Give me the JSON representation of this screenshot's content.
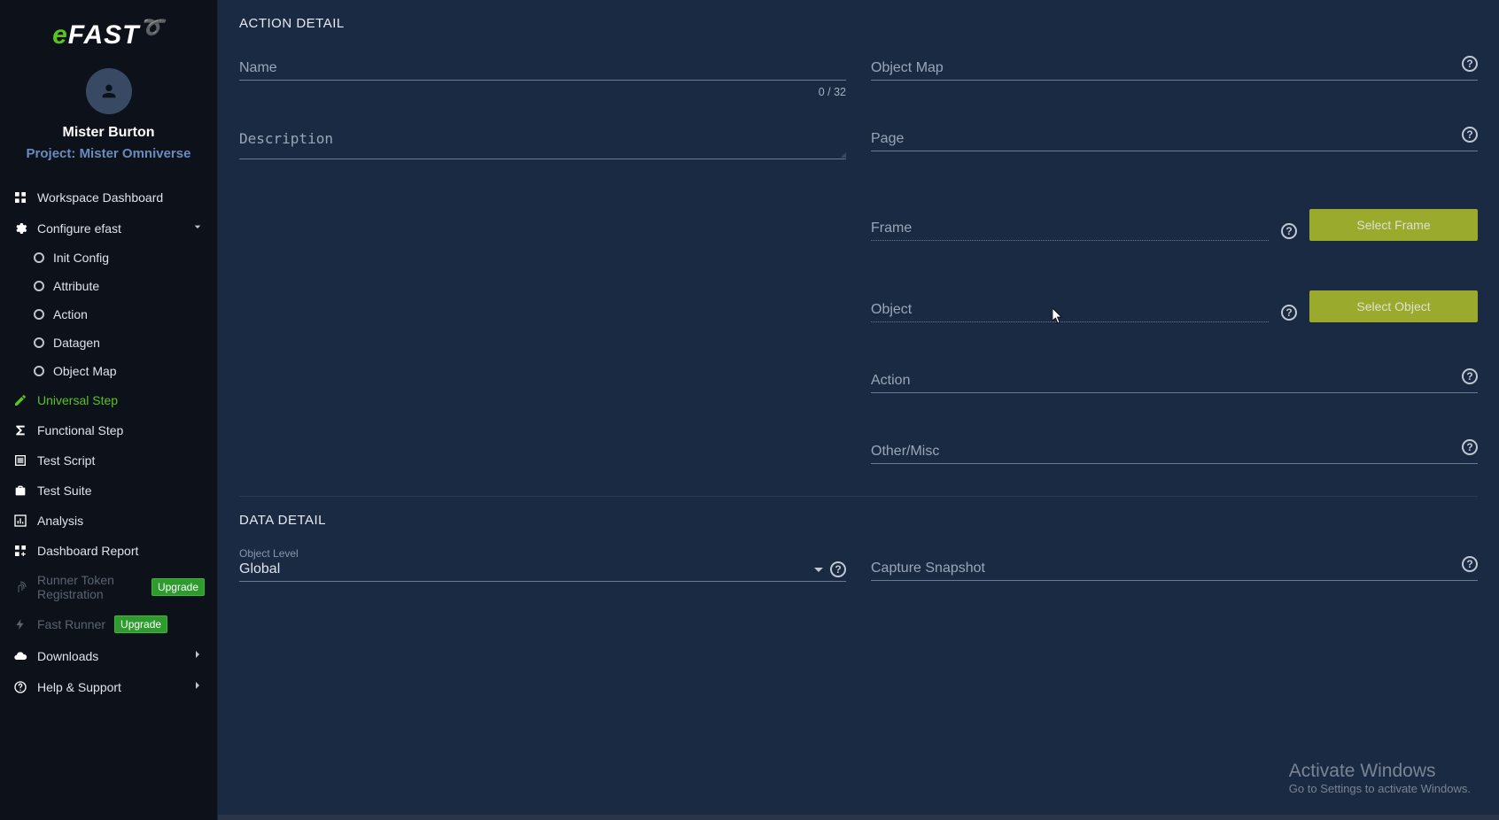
{
  "brand": {
    "e": "e",
    "rest": "FAST"
  },
  "user": {
    "name": "Mister Burton",
    "project_prefix": "Project: ",
    "project": "Mister Omniverse"
  },
  "sidebar": {
    "dashboard": "Workspace Dashboard",
    "configure": "Configure efast",
    "configure_children": {
      "init": "Init Config",
      "attribute": "Attribute",
      "action": "Action",
      "datagen": "Datagen",
      "objectmap": "Object Map"
    },
    "universal_step": "Universal Step",
    "functional_step": "Functional Step",
    "test_script": "Test Script",
    "test_suite": "Test Suite",
    "analysis": "Analysis",
    "dashboard_report": "Dashboard Report",
    "runner_token": "Runner Token Registration",
    "fast_runner": "Fast Runner",
    "downloads": "Downloads",
    "help": "Help & Support",
    "upgrade_badge": "Upgrade"
  },
  "sections": {
    "action_detail": "ACTION DETAIL",
    "data_detail": "DATA DETAIL"
  },
  "fields": {
    "name": {
      "label": "Name",
      "count": "0 / 32"
    },
    "description": {
      "label": "Description"
    },
    "object_map": {
      "label": "Object Map"
    },
    "page": {
      "label": "Page"
    },
    "frame": {
      "label": "Frame",
      "button": "Select Frame"
    },
    "object": {
      "label": "Object",
      "button": "Select Object"
    },
    "action": {
      "label": "Action"
    },
    "other": {
      "label": "Other/Misc"
    },
    "object_level": {
      "small_label": "Object Level",
      "value": "Global"
    },
    "capture_snapshot": {
      "label": "Capture Snapshot"
    }
  },
  "watermark": {
    "line1": "Activate Windows",
    "line2": "Go to Settings to activate Windows."
  }
}
